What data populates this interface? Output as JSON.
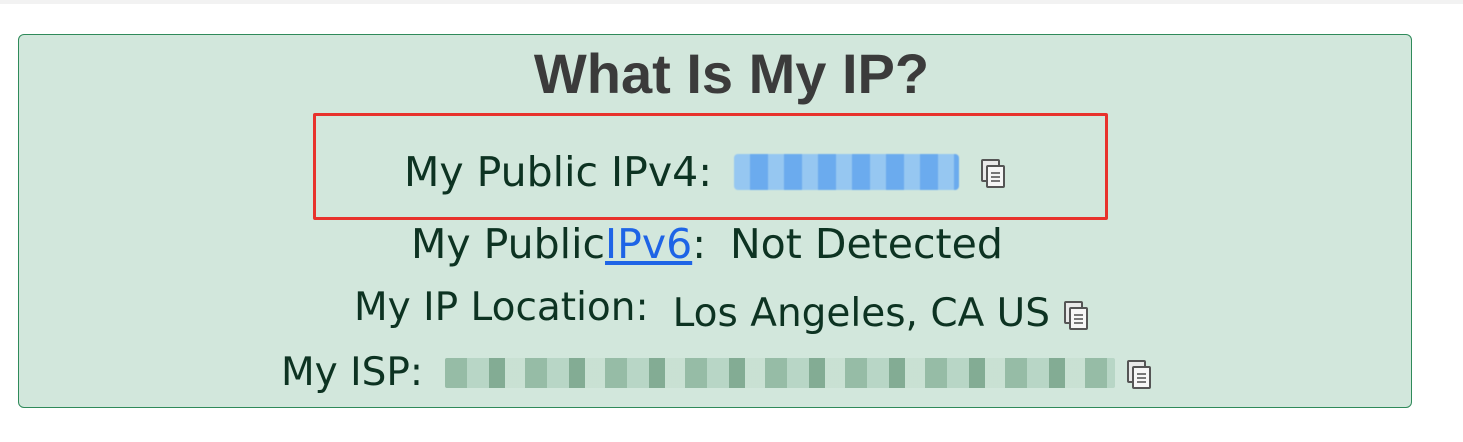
{
  "page": {
    "title": "What Is My IP?"
  },
  "rows": {
    "ipv4": {
      "label": "My Public IPv4:",
      "value": ""
    },
    "ipv6": {
      "label_prefix": "My Public ",
      "label_link": "IPv6",
      "label_suffix": ":",
      "value": "Not Detected"
    },
    "location": {
      "label": "My IP Location:",
      "value": "Los Angeles, CA US"
    },
    "isp": {
      "label": "My ISP:",
      "value": ""
    }
  },
  "icons": {
    "copy": "copy-icon"
  },
  "colors": {
    "card_bg": "#d2e7dc",
    "card_border": "#2f8a5a",
    "title": "#3b3b3b",
    "text": "#0d3322",
    "link": "#1e64e6",
    "highlight_box": "#e8322c"
  }
}
